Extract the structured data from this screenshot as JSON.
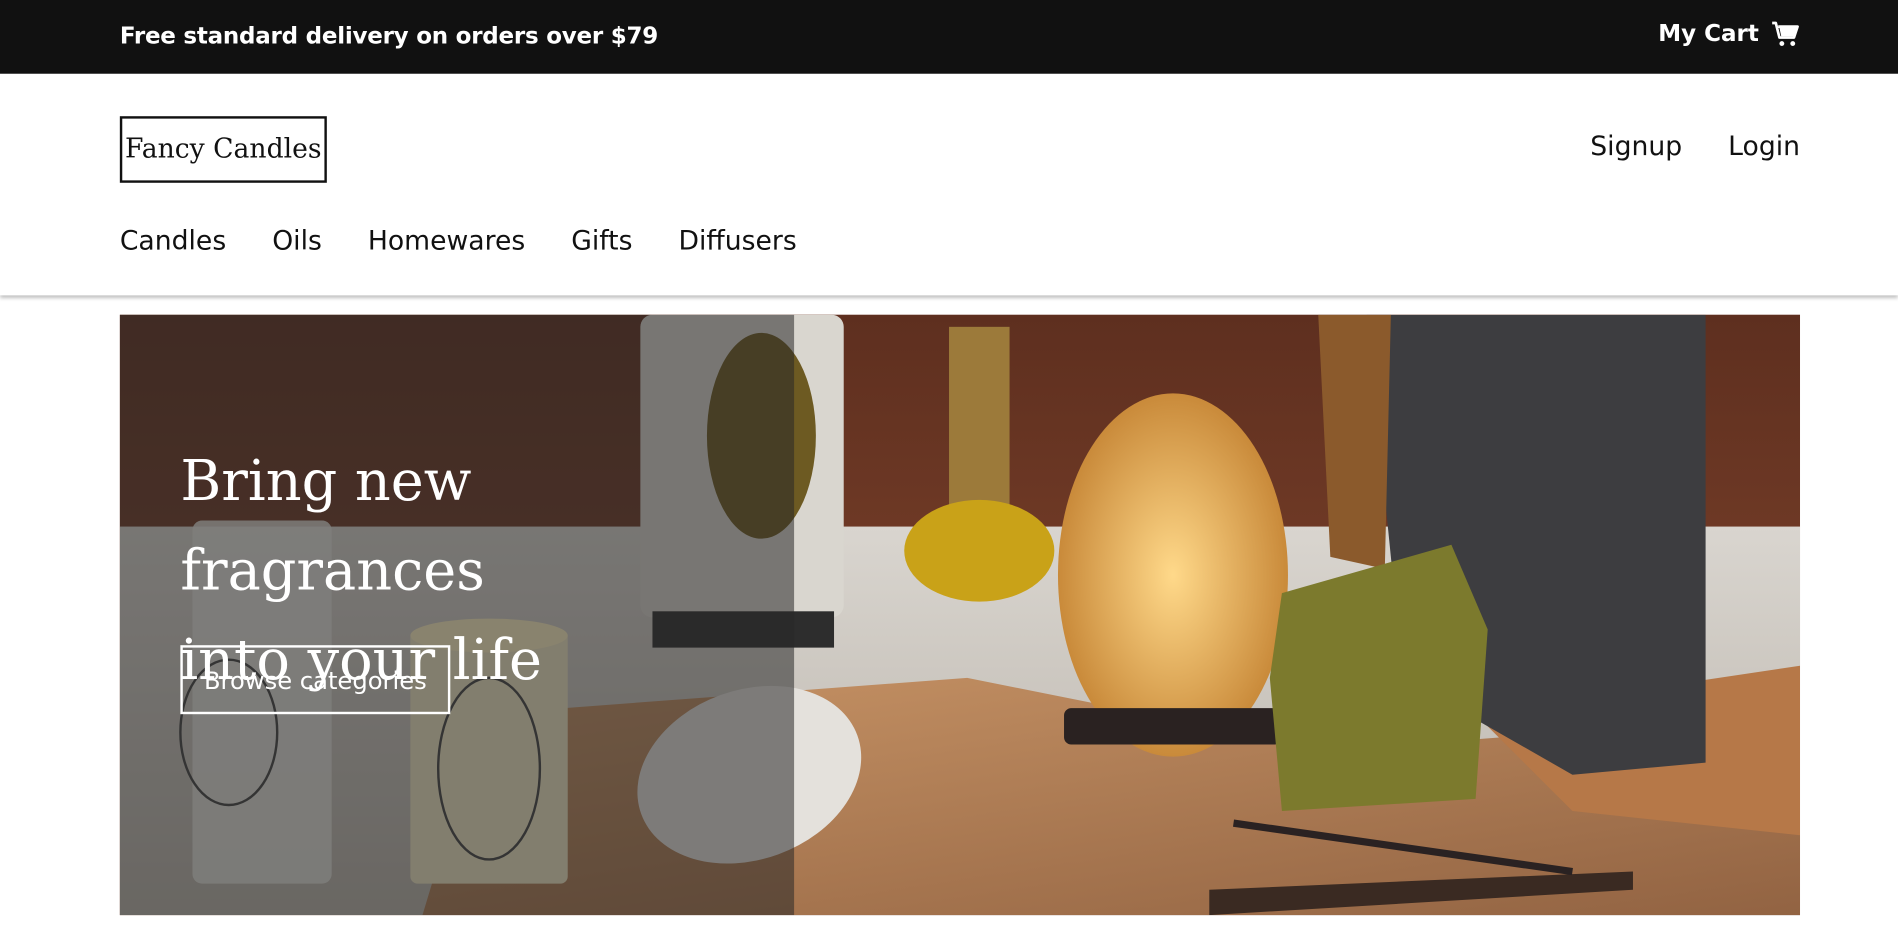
{
  "topbar": {
    "promo_text": "Free standard delivery on orders over $79",
    "cart_label": "My Cart",
    "cart_icon": "cart-icon"
  },
  "header": {
    "logo_text": "Fancy Candles",
    "auth": {
      "signup_label": "Signup",
      "login_label": "Login"
    },
    "nav": [
      "Candles",
      "Oils",
      "Homewares",
      "Gifts",
      "Diffusers"
    ]
  },
  "hero": {
    "headline_line1": "Bring new fragrances",
    "headline_line2": "into your life",
    "cta_label": "Browse categories"
  },
  "colors": {
    "topbar_bg": "#111111",
    "text_dark": "#111111",
    "white": "#ffffff"
  }
}
